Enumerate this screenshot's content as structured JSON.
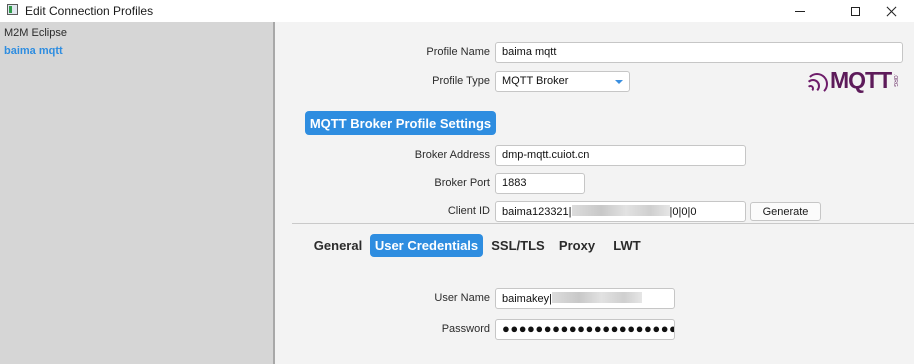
{
  "window": {
    "title": "Edit Connection Profiles"
  },
  "sidebar": {
    "items": [
      {
        "label": "M2M Eclipse"
      },
      {
        "label": "baima mqtt",
        "selected": true
      }
    ]
  },
  "profile": {
    "name_label": "Profile Name",
    "name_value": "baima mqtt",
    "type_label": "Profile Type",
    "type_value": "MQTT Broker",
    "logo_text": "MQTT",
    "logo_org": ".ORG"
  },
  "section": {
    "title": "MQTT Broker Profile Settings"
  },
  "broker": {
    "address_label": "Broker Address",
    "address_value": "dmp-mqtt.cuiot.cn",
    "port_label": "Broker Port",
    "port_value": "1883",
    "client_id_label": "Client ID",
    "client_id_prefix": "baima123321|",
    "client_id_suffix": "|0|0|0",
    "generate_label": "Generate"
  },
  "tabs": [
    {
      "label": "General"
    },
    {
      "label": "User Credentials",
      "active": true
    },
    {
      "label": "SSL/TLS"
    },
    {
      "label": "Proxy"
    },
    {
      "label": "LWT"
    }
  ],
  "credentials": {
    "user_label": "User Name",
    "user_value": "baimakey|",
    "password_label": "Password",
    "password_value": "●●●●●●●●●●●●●●●●●●●●●●●●●●●"
  },
  "colors": {
    "accent": "#2e8de0",
    "sidebar_bg": "#d6d6d6",
    "panel_bg": "#f3f3f3",
    "logo": "#5d1b5a"
  },
  "icons": {
    "app": "app-window-icon",
    "minimize": "minimize-icon",
    "maximize": "maximize-icon",
    "close": "close-icon",
    "dropdown": "chevron-down-icon"
  }
}
